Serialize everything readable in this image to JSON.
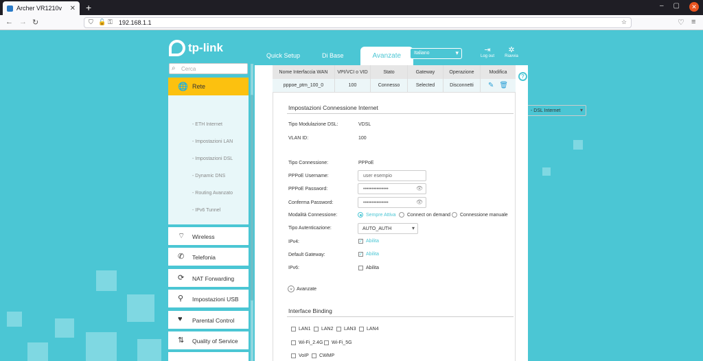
{
  "browser": {
    "tab_title": "Archer VR1210v",
    "tab_close": "✕",
    "new_tab": "+",
    "url": "192.168.1.1",
    "window_controls": [
      "–",
      "▢",
      "✕"
    ]
  },
  "header": {
    "logo_text": "tp-link",
    "tabs": [
      {
        "label": "Quick Setup",
        "active": false
      },
      {
        "label": "Di Base",
        "active": false
      },
      {
        "label": "Avanzate",
        "active": true
      }
    ],
    "language": "Italiano",
    "logout_label": "Log out",
    "reboot_label": "Riavvia"
  },
  "sidebar": {
    "search_placeholder": "Cerca",
    "rete_label": "Rete",
    "sub_items": [
      {
        "label": "- DSL Internet",
        "selected": true
      },
      {
        "label": "- ETH Internet",
        "selected": false
      },
      {
        "label": "- Impostazioni LAN",
        "selected": false
      },
      {
        "label": "- Impostazioni DSL",
        "selected": false
      },
      {
        "label": "- Dynamic DNS",
        "selected": false
      },
      {
        "label": "- Routing Avanzato",
        "selected": false
      },
      {
        "label": "- IPv6 Tunnel",
        "selected": false
      }
    ],
    "items": [
      {
        "label": "Wireless",
        "icon": "wifi-icon"
      },
      {
        "label": "Telefonia",
        "icon": "phone-icon"
      },
      {
        "label": "NAT Forwarding",
        "icon": "nat-icon"
      },
      {
        "label": "Impostazioni USB",
        "icon": "usb-icon"
      },
      {
        "label": "Parental Control",
        "icon": "heart-icon"
      },
      {
        "label": "Quality of Service",
        "icon": "qos-icon"
      }
    ]
  },
  "table": {
    "headers": [
      "Nome Interfaccia WAN",
      "VPI/VCI o VID",
      "Stato",
      "Gateway",
      "Operazione",
      "Modifica"
    ],
    "row": [
      "pppoe_ptm_100_0",
      "100",
      "Connesso",
      "Selected",
      "Disconnetti"
    ]
  },
  "form": {
    "section_title": "Impostazioni Connessione Internet",
    "dsl_mod_label": "Tipo Modulazione DSL:",
    "dsl_mod_value": "VDSL",
    "vlan_label": "VLAN ID:",
    "vlan_value": "100",
    "conn_type_label": "Tipo Connessione:",
    "conn_type_value": "PPPoE",
    "username_label": "PPPoE Username:",
    "username_value": "user esempio",
    "password_label": "PPPoE Password:",
    "password_value": "•••••••••••••••",
    "confirm_label": "Conferma Password:",
    "confirm_value": "•••••••••••••••",
    "mode_label": "Modalità Connessione:",
    "mode_options": [
      "Sempre Attiva",
      "Connect on demand",
      "Connessione manuale"
    ],
    "mode_selected": 0,
    "auth_label": "Tipo Autenticazione:",
    "auth_value": "AUTO_AUTH",
    "ipv4_label": "IPv4:",
    "default_gw_label": "Default Gateway:",
    "ipv6_label": "IPv6:",
    "enable_label": "Abilita",
    "advanced_label": "Avanzate",
    "binding_title": "Interface Binding",
    "bindings": [
      "LAN1",
      "LAN2",
      "LAN3",
      "LAN4",
      "Wi-Fi_2.4G",
      "Wi-Fi_5G",
      "VoIP",
      "CWMP"
    ]
  },
  "colors": {
    "accent": "#4bc6d4",
    "active_menu": "#fcc10f",
    "disconnect": "#6aa84f"
  }
}
